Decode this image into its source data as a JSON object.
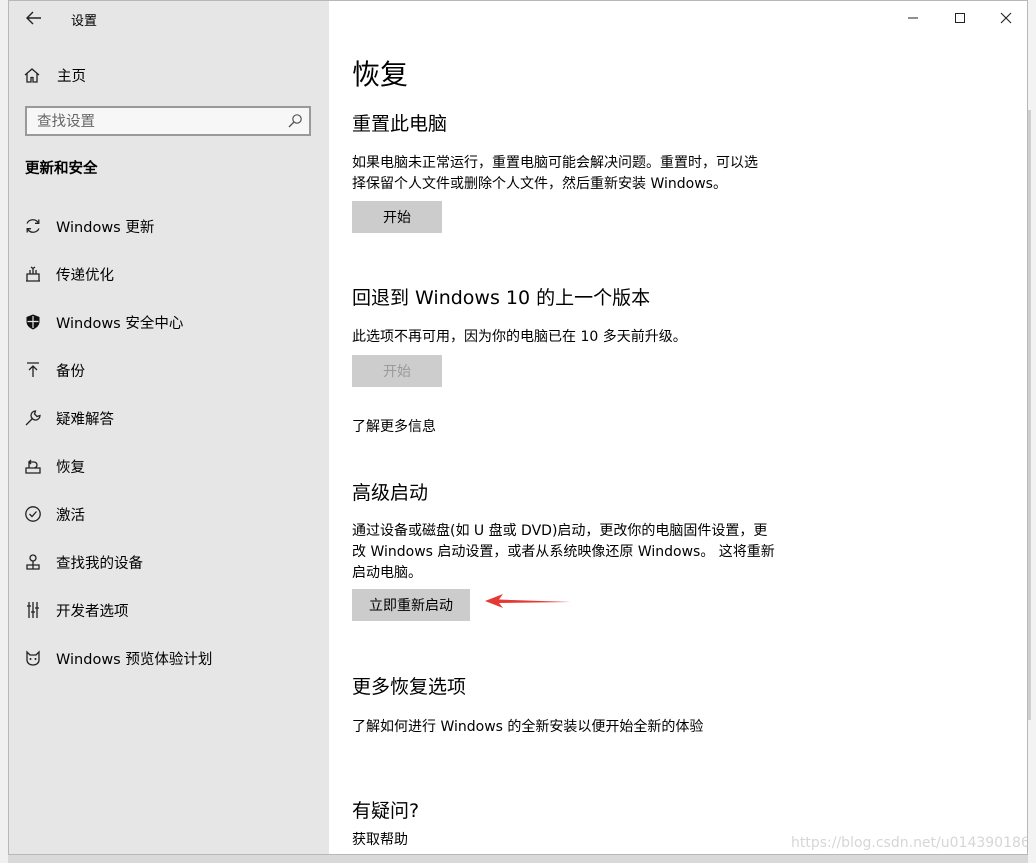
{
  "window": {
    "title": "设置",
    "controls": {
      "minimize": "—",
      "maximize": "☐",
      "close": "✕"
    }
  },
  "sidebar": {
    "home_label": "主页",
    "search_placeholder": "查找设置",
    "section_title": "更新和安全",
    "items": [
      {
        "icon": "sync-icon",
        "label": "Windows 更新"
      },
      {
        "icon": "delivery-optimization-icon",
        "label": "传递优化"
      },
      {
        "icon": "shield-icon",
        "label": "Windows 安全中心"
      },
      {
        "icon": "backup-arrow-icon",
        "label": "备份"
      },
      {
        "icon": "wrench-icon",
        "label": "疑难解答"
      },
      {
        "icon": "recovery-icon",
        "label": "恢复"
      },
      {
        "icon": "activation-check-icon",
        "label": "激活"
      },
      {
        "icon": "find-device-icon",
        "label": "查找我的设备"
      },
      {
        "icon": "developer-tools-icon",
        "label": "开发者选项"
      },
      {
        "icon": "insider-cat-icon",
        "label": "Windows 预览体验计划"
      }
    ]
  },
  "main": {
    "title": "恢复",
    "reset": {
      "heading": "重置此电脑",
      "text_line1": "如果电脑未正常运行，重置电脑可能会解决问题。重置时，可以选",
      "text_line2": "择保留个人文件或删除个人文件，然后重新安装 Windows。",
      "button": "开始"
    },
    "rollback": {
      "heading": "回退到 Windows 10 的上一个版本",
      "text": "此选项不再可用，因为你的电脑已在 10 多天前升级。",
      "button": "开始",
      "link": "了解更多信息"
    },
    "advanced": {
      "heading": "高级启动",
      "text_line1": "通过设备或磁盘(如 U 盘或 DVD)启动，更改你的电脑固件设置，更",
      "text_line2": "改 Windows 启动设置，或者从系统映像还原 Windows。 这将重新",
      "text_line3": "启动电脑。",
      "button": "立即重新启动"
    },
    "more": {
      "heading": "更多恢复选项",
      "link": "了解如何进行 Windows 的全新安装以便开始全新的体验"
    },
    "help": {
      "heading": "有疑问?",
      "link": "获取帮助"
    }
  },
  "watermark": "https://blog.csdn.net/u014390186",
  "colors": {
    "sidebar_bg": "#e6e6e6",
    "button_bg": "#cccccc",
    "annotation_arrow": "#e53935"
  }
}
